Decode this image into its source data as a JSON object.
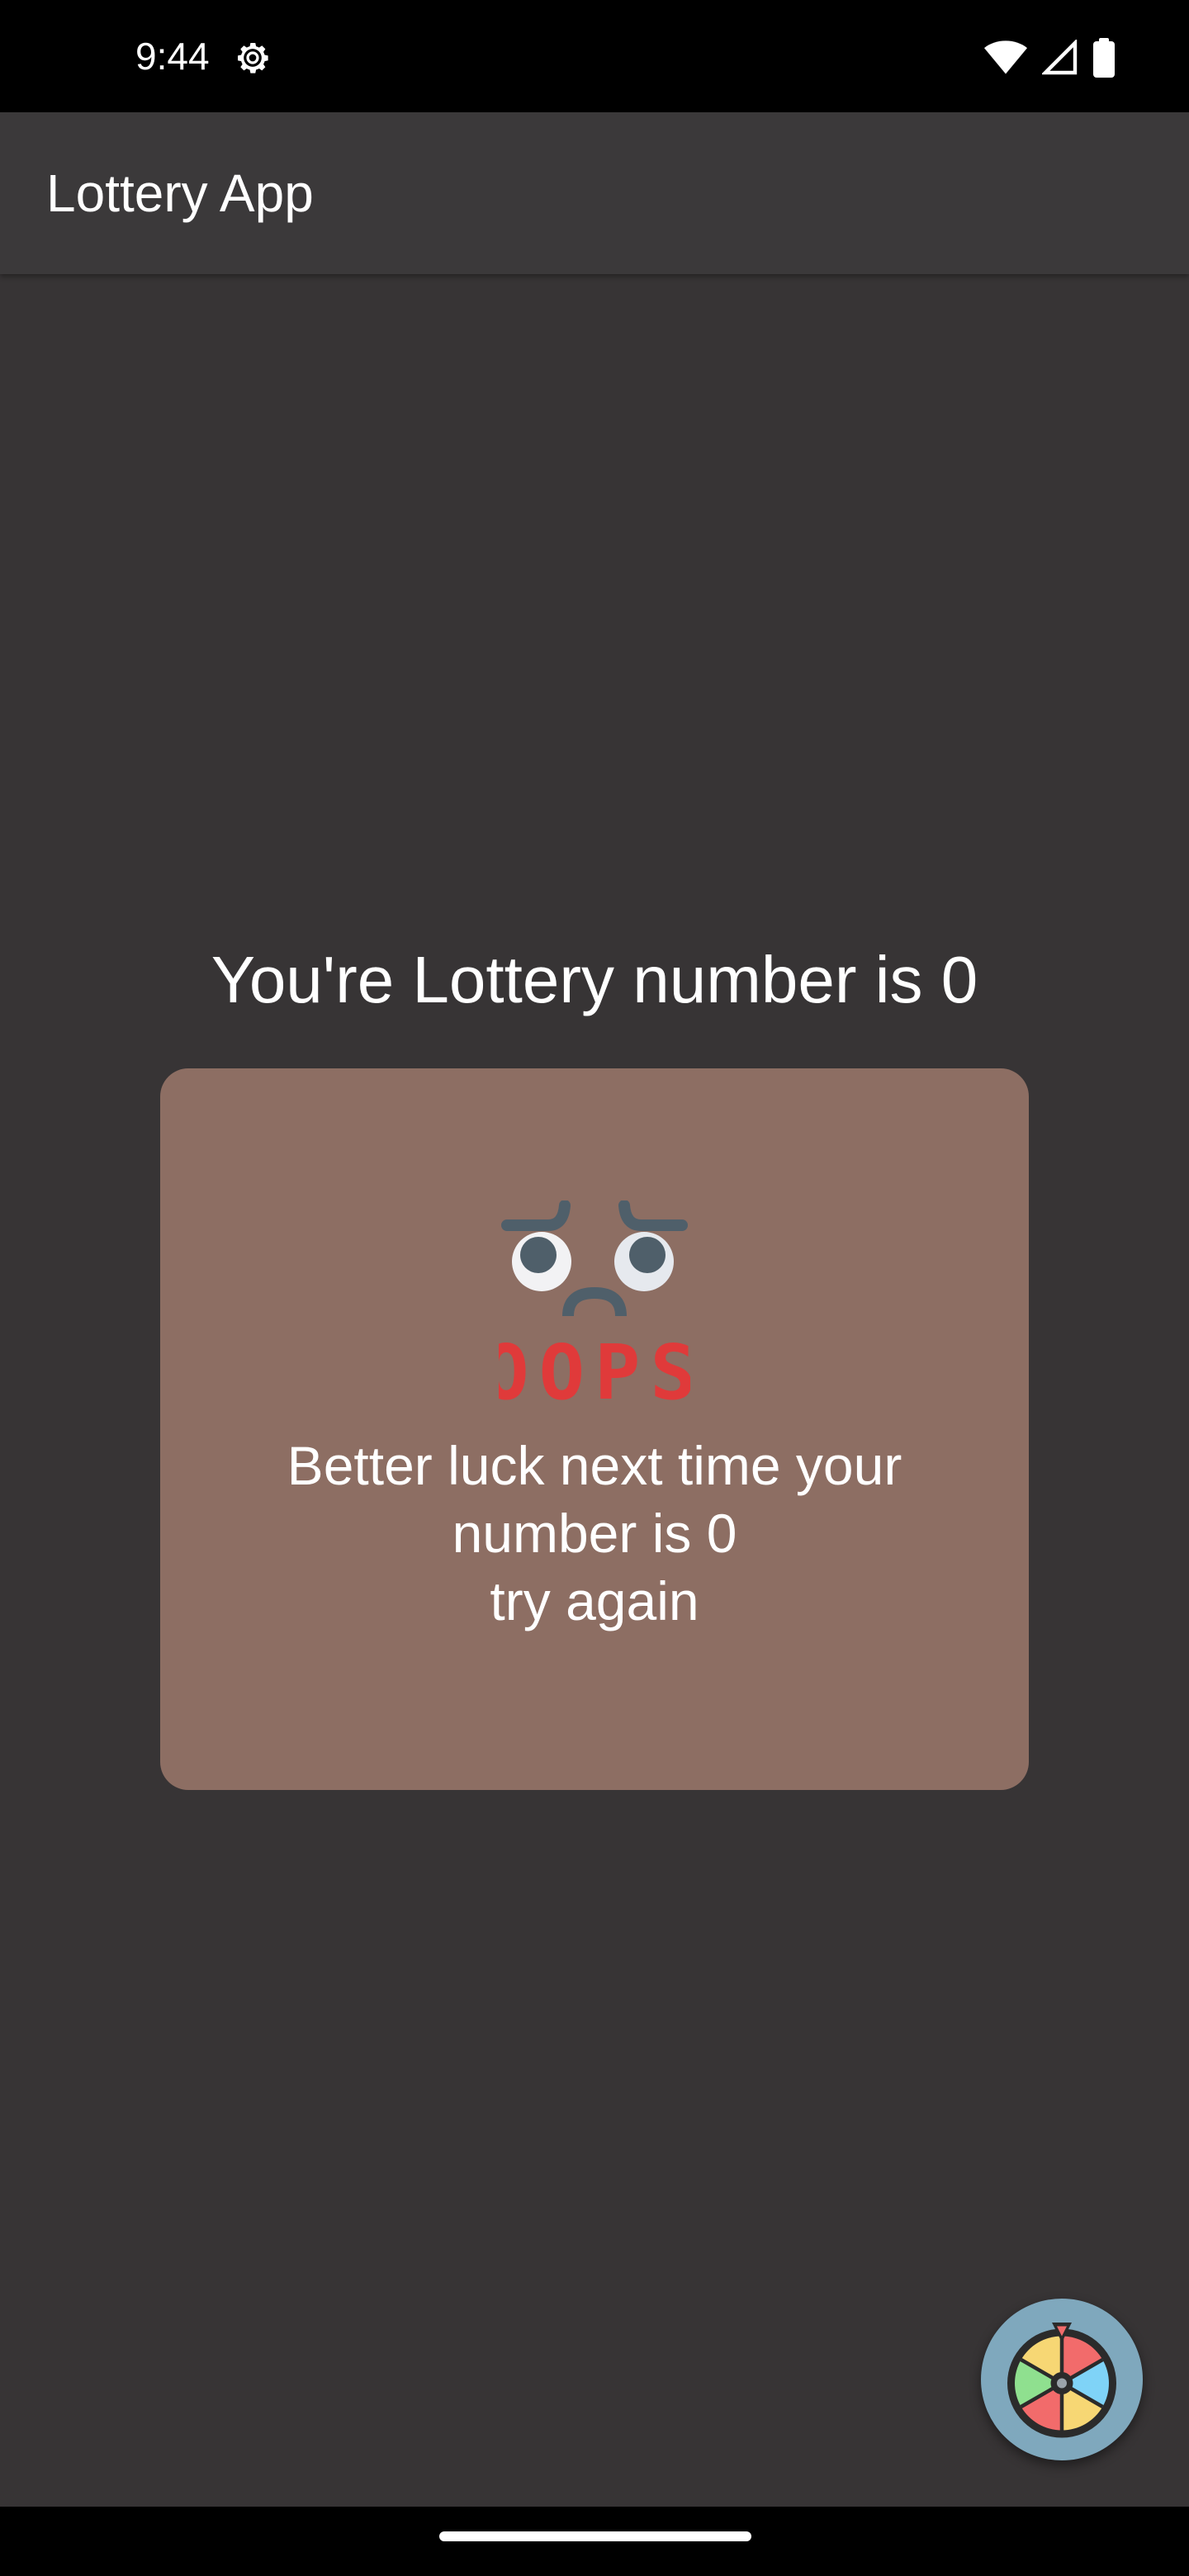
{
  "status_bar": {
    "time": "9:44",
    "icons": [
      "settings-gear-icon",
      "wifi-icon",
      "cell-signal-icon",
      "battery-icon"
    ]
  },
  "app_bar": {
    "title": "Lottery App"
  },
  "main": {
    "headline": "You're Lottery number is 0",
    "card": {
      "image_icon": "oops-sad-face-icon",
      "image_text": "OOPS",
      "message_lines": [
        "Better luck next time your",
        "number is 0",
        "try again"
      ],
      "background_color": "#8d6e63"
    }
  },
  "fab": {
    "icon": "spin-wheel-icon"
  },
  "colors": {
    "background": "#373435",
    "app_bar": "#3b393a",
    "fab": "#7fa8bd",
    "oops_text": "#e03a3a"
  }
}
